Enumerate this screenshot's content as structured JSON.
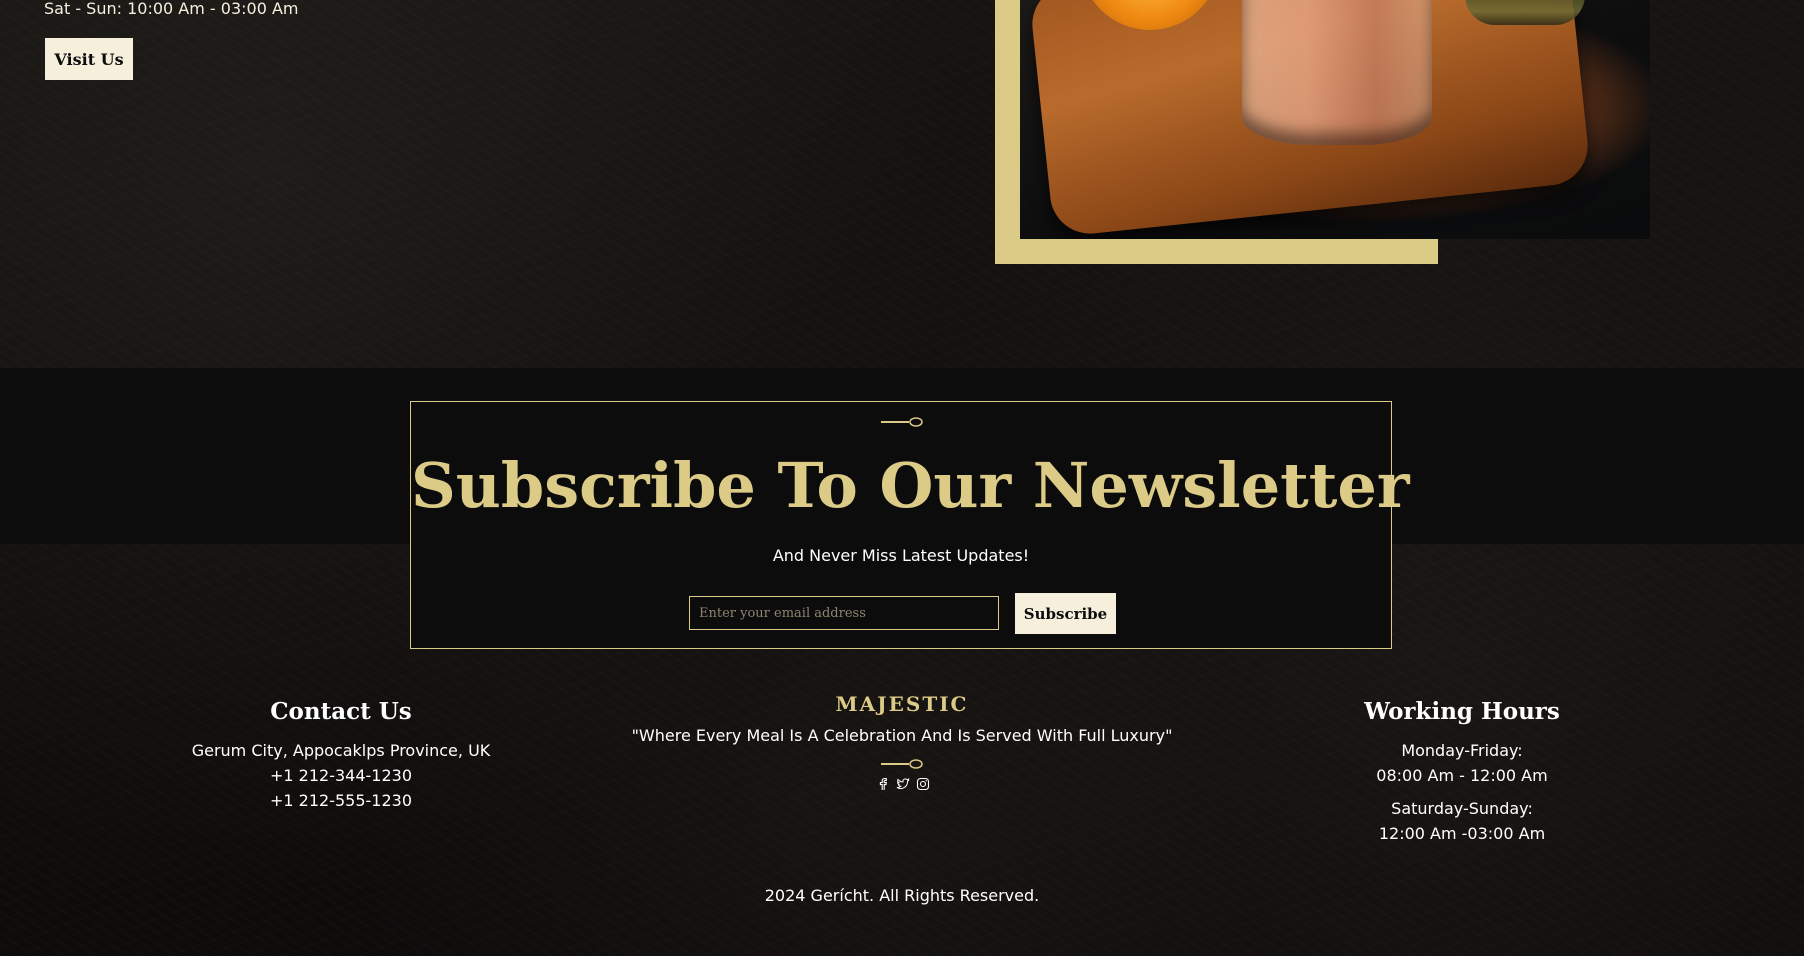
{
  "top": {
    "hours_line": "Sat - Sun: 10:00 Am - 03:00 Am",
    "visit_button": "Visit Us"
  },
  "newsletter": {
    "title": "Subscribe To Our Newsletter",
    "subtitle": "And Never Miss Latest Updates!",
    "email_placeholder": "Enter your email address",
    "subscribe_button": "Subscribe"
  },
  "footer": {
    "contact": {
      "title": "Contact Us",
      "address": "Gerum City, Appocaklps Province, UK",
      "phone_1": "+1 212-344-1230",
      "phone_2": "+1 212-555-1230"
    },
    "brand": {
      "name": "MAJESTIC",
      "tagline": "\"Where Every Meal Is A Celebration And Is Served With Full Luxury\"",
      "social_icons": [
        "facebook-icon",
        "twitter-icon",
        "instagram-icon"
      ]
    },
    "hours": {
      "title": "Working Hours",
      "weekday_label": "Monday-Friday:",
      "weekday_hours": "08:00 Am - 12:00 Am",
      "weekend_label": "Saturday-Sunday:",
      "weekend_hours": "12:00 Am -03:00 Am"
    },
    "copyright": "2024 Gerícht. All Rights Reserved."
  },
  "colors": {
    "gold": "#dcca87",
    "cream": "#f5efdb",
    "black": "#0c0c0c",
    "white": "#ffffff"
  }
}
